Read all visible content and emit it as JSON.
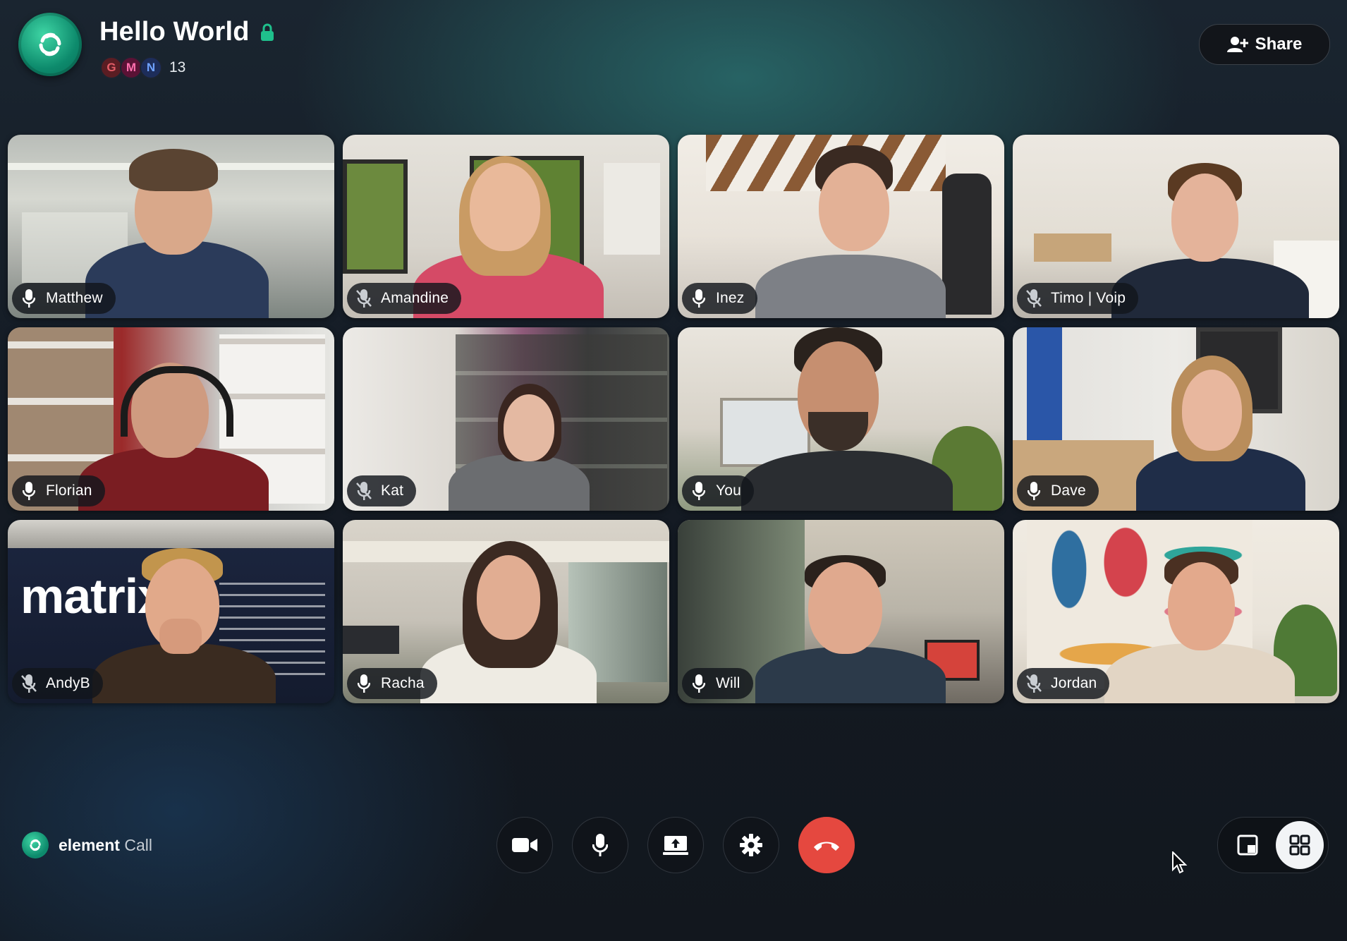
{
  "header": {
    "room_title": "Hello World",
    "members": [
      {
        "initial": "G",
        "color": "#5a1d23",
        "text_color": "#e35d67"
      },
      {
        "initial": "M",
        "color": "#5a1235",
        "text_color": "#ff6fae"
      },
      {
        "initial": "N",
        "color": "#1d2d5a",
        "text_color": "#6fa2ff"
      }
    ],
    "member_count": "13",
    "share_label": "Share"
  },
  "participants": [
    {
      "name": "Matthew",
      "muted": false
    },
    {
      "name": "Amandine",
      "muted": true
    },
    {
      "name": "Inez",
      "muted": false
    },
    {
      "name": "Timo | Voip",
      "muted": true
    },
    {
      "name": "Florian",
      "muted": false
    },
    {
      "name": "Kat",
      "muted": true
    },
    {
      "name": "You",
      "muted": false
    },
    {
      "name": "Dave",
      "muted": false
    },
    {
      "name": "AndyB",
      "muted": true
    },
    {
      "name": "Racha",
      "muted": false
    },
    {
      "name": "Will",
      "muted": false
    },
    {
      "name": "Jordan",
      "muted": true
    }
  ],
  "background_text": {
    "matrix_banner": "matrix"
  },
  "footer": {
    "brand_bold": "element",
    "brand_light": "Call"
  },
  "controls": [
    "video-camera-icon",
    "microphone-icon",
    "screen-share-icon",
    "settings-gear-icon",
    "hang-up-icon"
  ],
  "layout_modes": [
    "spotlight",
    "grid"
  ],
  "active_layout": "grid",
  "colors": {
    "accent": "#0dbd8b",
    "hangup": "#e5483f"
  }
}
